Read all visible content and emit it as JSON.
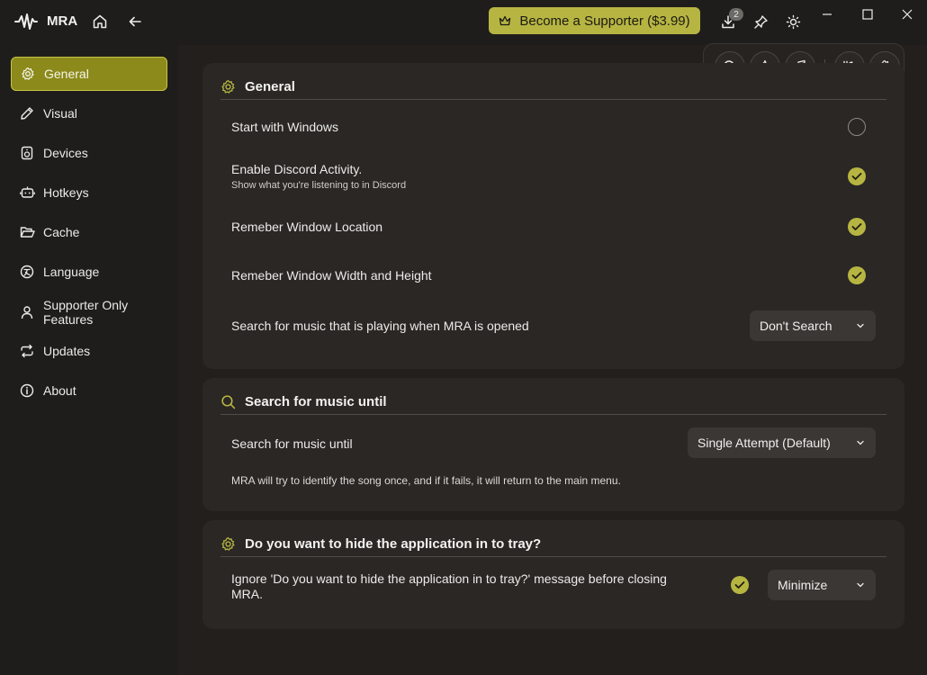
{
  "app": {
    "title": "MRA"
  },
  "titlebar": {
    "supporter_label": "Become a Supporter ($3.99)",
    "download_count": "2"
  },
  "sidebar": {
    "items": [
      {
        "label": "General",
        "icon": "gear-icon"
      },
      {
        "label": "Visual",
        "icon": "pencil-icon"
      },
      {
        "label": "Devices",
        "icon": "speaker-icon"
      },
      {
        "label": "Hotkeys",
        "icon": "robot-icon"
      },
      {
        "label": "Cache",
        "icon": "folder-open-icon"
      },
      {
        "label": "Language",
        "icon": "language-icon"
      },
      {
        "label": "Supporter Only Features",
        "icon": "person-icon"
      },
      {
        "label": "Updates",
        "icon": "refresh-icon"
      },
      {
        "label": "About",
        "icon": "info-icon"
      }
    ]
  },
  "general": {
    "title": "General",
    "start_windows": "Start with Windows",
    "discord": "Enable Discord Activity.",
    "discord_sub": "Show what you're listening to in Discord",
    "remember_location": "Remeber Window Location",
    "remember_size": "Remeber Window Width and Height",
    "search_on_open": "Search for music that is playing when MRA is opened",
    "search_on_open_value": "Don't Search"
  },
  "search_until": {
    "title": "Search for music until",
    "label": "Search for music until",
    "value": "Single Attempt (Default)",
    "note": "MRA will try to identify the song once, and if it fails, it will return to the main menu."
  },
  "tray": {
    "title": "Do you want to hide the application in to tray?",
    "label_line1": "Ignore 'Do you want to hide the application in to tray?' message before closing",
    "label_line2": "MRA.",
    "value": "Minimize"
  },
  "colors": {
    "accent": "#b7b542",
    "active_nav": "#8b8a1b",
    "card": "#2a2725",
    "background": "#1f1d1b"
  }
}
